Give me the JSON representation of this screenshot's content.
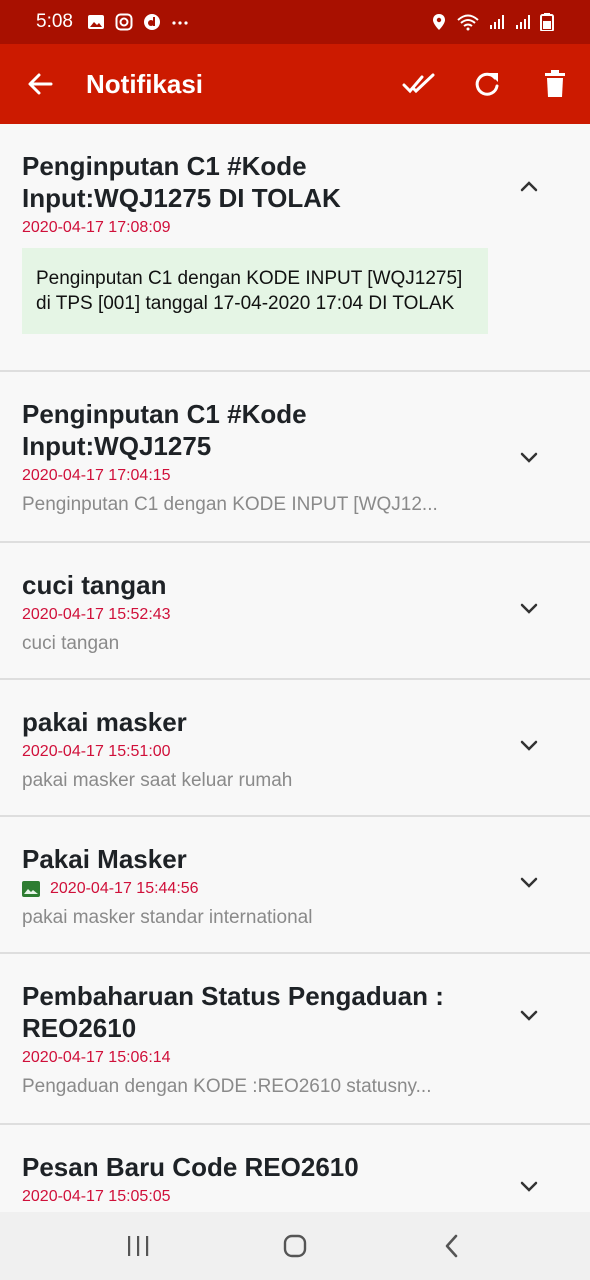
{
  "status_bar": {
    "time": "5:08"
  },
  "app_bar": {
    "title": "Notifikasi"
  },
  "notifications": [
    {
      "title": "Penginputan C1 #Kode Input:WQJ1275 DI TOLAK",
      "date": "2020-04-17 17:08:09",
      "body": "Penginputan C1 dengan KODE INPUT [WQJ1275] di TPS [001] tanggal 17-04-2020 17:04 DI TOLAK",
      "expanded": true
    },
    {
      "title": "Penginputan C1 #Kode Input:WQJ1275",
      "date": "2020-04-17 17:04:15",
      "snippet": "Penginputan C1 dengan KODE INPUT [WQJ12..."
    },
    {
      "title": "cuci tangan",
      "date": "2020-04-17 15:52:43",
      "snippet": "cuci tangan"
    },
    {
      "title": "pakai masker",
      "date": "2020-04-17 15:51:00",
      "snippet": "pakai masker saat keluar rumah"
    },
    {
      "title": "Pakai Masker",
      "date": "2020-04-17 15:44:56",
      "snippet": "pakai masker standar international",
      "has_image": true
    },
    {
      "title": "Pembaharuan Status Pengaduan : REO2610",
      "date": "2020-04-17 15:06:14",
      "snippet": "Pengaduan dengan KODE :REO2610 statusny..."
    },
    {
      "title": "Pesan Baru Code REO2610",
      "date": "2020-04-17 15:05:05",
      "snippet": ""
    }
  ],
  "colors": {
    "status_bar": "#a81000",
    "app_bar": "#cc1a00",
    "date": "#d0103a",
    "expanded_body_bg": "#e5f5e5"
  }
}
